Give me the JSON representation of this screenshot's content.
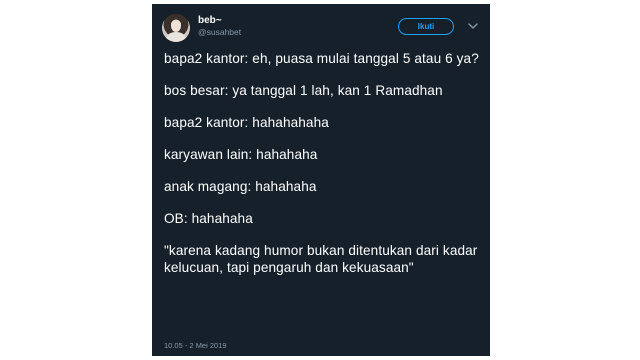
{
  "tweet": {
    "author": {
      "display_name": "beb~",
      "handle": "@susahbet"
    },
    "follow_label": "Ikuti",
    "lines": [
      "bapa2 kantor: eh, puasa mulai tanggal 5 atau 6 ya?",
      "bos besar: ya tanggal 1 lah, kan 1 Ramadhan",
      "bapa2 kantor: hahahahaha",
      "karyawan lain: hahahaha",
      "anak magang: hahahaha",
      "OB: hahahaha",
      "\"karena kadang humor bukan ditentukan dari kadar kelucuan, tapi pengaruh dan kekuasaan\""
    ],
    "timestamp": "10.05 - 2 Mei 2019"
  },
  "colors": {
    "background": "#15202b",
    "accent": "#1da1f2",
    "muted": "#8899a6"
  }
}
